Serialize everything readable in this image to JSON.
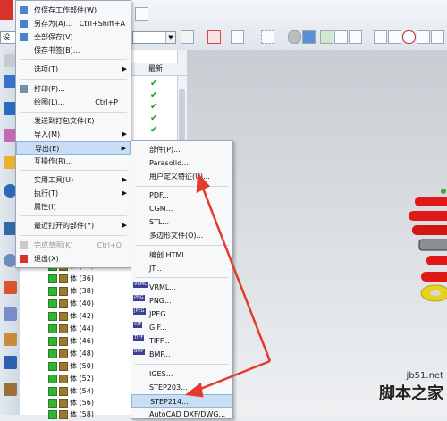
{
  "toolbar": {
    "left_combo": "设",
    "icons": [
      "file-icon",
      "select-filter-icon",
      "snap-icon",
      "view-icon",
      "orient-icon",
      "shade-icon",
      "grid-icon",
      "curve-icon",
      "line-icon",
      "arc-icon",
      "point-icon",
      "circle-icon",
      "plus-icon"
    ]
  },
  "navigator": {
    "column_header": "最新",
    "checks": 5,
    "rows": [
      "体 (34)",
      "体 (36)",
      "体 (38)",
      "体 (40)",
      "体 (42)",
      "体 (44)",
      "体 (46)",
      "体 (48)",
      "体 (50)",
      "体 (52)",
      "体 (54)",
      "体 (56)",
      "体 (58)"
    ]
  },
  "file_menu": {
    "items": [
      {
        "label": "仅保存工作部件(W)",
        "shortcut": ""
      },
      {
        "label": "另存为(A)...",
        "shortcut": "Ctrl+Shift+A"
      },
      {
        "label": "全部保存(V)",
        "shortcut": ""
      },
      {
        "label": "保存书签(B)...",
        "shortcut": ""
      },
      {
        "label": "选项(T)",
        "shortcut": ""
      },
      {
        "label": "打印(P)...",
        "shortcut": ""
      },
      {
        "label": "绘图(L)...",
        "shortcut": "Ctrl+P"
      },
      {
        "label": "发送到打包文件(K)",
        "shortcut": ""
      },
      {
        "label": "导入(M)",
        "shortcut": ""
      },
      {
        "label": "导出(E)",
        "shortcut": ""
      },
      {
        "label": "互操作(R)...",
        "shortcut": ""
      },
      {
        "label": "实用工具(U)",
        "shortcut": ""
      },
      {
        "label": "执行(T)",
        "shortcut": ""
      },
      {
        "label": "属性(I)",
        "shortcut": ""
      },
      {
        "label": "最近打开的部件(Y)",
        "shortcut": ""
      },
      {
        "label": "完成草图(K)",
        "shortcut": "Ctrl+Q"
      },
      {
        "label": "退出(X)",
        "shortcut": ""
      }
    ]
  },
  "export_menu": {
    "items": [
      {
        "label": "部件(P)..."
      },
      {
        "label": "Parasolid..."
      },
      {
        "label": "用户定义特征(U)..."
      },
      {
        "label": "PDF..."
      },
      {
        "label": "CGM..."
      },
      {
        "label": "STL..."
      },
      {
        "label": "多边形文件(O)..."
      },
      {
        "label": "编创 HTML..."
      },
      {
        "label": "JT..."
      },
      {
        "label": "VRML..."
      },
      {
        "label": "PNG..."
      },
      {
        "label": "JPEG..."
      },
      {
        "label": "GIF..."
      },
      {
        "label": "TIFF..."
      },
      {
        "label": "BMP..."
      },
      {
        "label": "IGES..."
      },
      {
        "label": "STEP203..."
      },
      {
        "label": "STEP214..."
      },
      {
        "label": "AutoCAD DXF/DWG..."
      }
    ],
    "image_tags": [
      "VRML",
      "PNG",
      "JPEG",
      "GIF",
      "TIFF",
      "BMP"
    ]
  },
  "watermark": {
    "site": "jb51.net",
    "name": "脚本之家"
  },
  "colors": {
    "highlight": "#c9def5",
    "arrow": "#e23a2c",
    "check": "#1aa31a",
    "model_red": "#e01818",
    "model_yellow": "#e8d220"
  }
}
